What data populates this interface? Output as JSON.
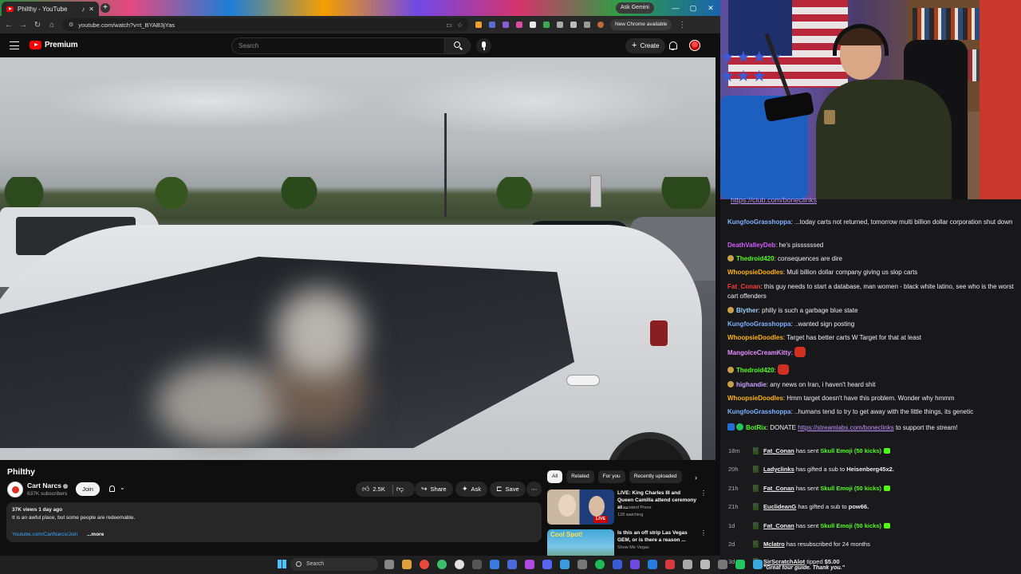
{
  "browser": {
    "tab_title": "Philthy - YouTube",
    "new_tab_symbol": "+",
    "ask_gemini": "Ask Gemini",
    "url": "youtube.com/watch?v=t_BYAB3jYas",
    "new_chrome": "New Chrome available"
  },
  "youtube": {
    "logo_text": "Premium",
    "search_placeholder": "Search",
    "create_label": "Create",
    "video": {
      "title": "Philthy",
      "channel": "Cart Narcs",
      "subscribers": "637K subscribers",
      "join_label": "Join",
      "likes": "2.5K",
      "share_label": "Share",
      "ask_label": "Ask",
      "save_label": "Save",
      "views_date": "37K views  1 day ago",
      "description": "It is an awful place, but some people are redeemable.",
      "desc_link": "Youtube.com/CartNarcs/Join",
      "more_label": "...more"
    },
    "chips": [
      "All",
      "Related",
      "For you",
      "Recently uploaded"
    ],
    "related": [
      {
        "title": "LIVE: King Charles III and Queen Camilla attend ceremony at ...",
        "channel": "Associated Press",
        "stat": "128 watching",
        "badge": "LIVE"
      },
      {
        "title": "Is this an off strip Las Vegas GEM, or is there a reason ...",
        "channel": "Show Me Vegas",
        "stat": ""
      }
    ]
  },
  "stream": {
    "chat_link_top": "https://club.com/boneclinks",
    "messages": [
      {
        "user": "KungfooGrasshoppa",
        "color": "#7fb2ff",
        "text": "...today carts not returned, tomorrow multi billion dollar corporation shut down"
      },
      {
        "user": "DeathValleyDeb",
        "color": "#d35cff",
        "text": "he's pissssssed"
      },
      {
        "user": "Thedroid420",
        "color": "#53fc18",
        "text": "consequences are dire",
        "badge": true
      },
      {
        "user": "WhoopsieDoodles",
        "color": "#ffb300",
        "text": "Muli billion dollar company giving us slop carts"
      },
      {
        "user": "Fat_Conan",
        "color": "#ff3b3b",
        "text": "this guy needs to start a database, man women - black white latino, see who is the worst cart offenders"
      },
      {
        "user": "Blyther",
        "color": "#9ad0ff",
        "text": "philly is such a garbage blue state",
        "badge": true
      },
      {
        "user": "KungfooGrasshoppa",
        "color": "#7fb2ff",
        "text": "..wanted sign posting"
      },
      {
        "user": "WhoopsieDoodles",
        "color": "#ffb300",
        "text": "Target has better carts W Target for that at least"
      },
      {
        "user": "MangoIceCreamKitty",
        "color": "#e68cff",
        "text": "",
        "emote": true
      },
      {
        "user": "Thedroid420",
        "color": "#53fc18",
        "text": "",
        "badge": true,
        "emote": true
      },
      {
        "user": "highandie",
        "color": "#c6a3ff",
        "text": "any news on Iran, i haven't heard shit",
        "badge": true
      },
      {
        "user": "WhoopsieDoodles",
        "color": "#ffb300",
        "text": "Hmm target doesn't have this problem. Wonder why hmmm"
      },
      {
        "user": "KungfooGrasshoppa",
        "color": "#7fb2ff",
        "text": "..humans tend to try to get away with the little things, its genetic"
      }
    ],
    "bot_message": {
      "user": "BotRix",
      "prefix": "DONATE",
      "link": "https://streamlabs.com/boneclinks",
      "suffix": "to support the stream!"
    },
    "events": [
      {
        "time": "18m",
        "user": "Fat_Conan",
        "action": "has sent",
        "item": "Skull Emoji (50 kicks)",
        "coin": true
      },
      {
        "time": "20h",
        "user": "Ladyclinks",
        "action": "has gifted a sub to",
        "item": "Heisenberg45x2."
      },
      {
        "time": "21h",
        "user": "Fat_Conan",
        "action": "has sent",
        "item": "Skull Emoji (50 kicks)",
        "coin": true
      },
      {
        "time": "21h",
        "user": "EuclideanG",
        "action": "has gifted a sub to",
        "item": "pow66."
      },
      {
        "time": "1d",
        "user": "Fat_Conan",
        "action": "has sent",
        "item": "Skull Emoji (50 kicks)",
        "coin": true
      },
      {
        "time": "2d",
        "user": "Mclatro",
        "action": "has resubscribed for 24 months",
        "item": ""
      },
      {
        "time": "3d",
        "user": "SirScratchAlot",
        "action": "tipped",
        "item": "$5.00",
        "quote": "\"Great tour guide. Thank you.\""
      }
    ]
  },
  "taskbar": {
    "search_label": "Search"
  },
  "colors": {
    "yt_red": "#ff0000",
    "link_blue": "#3ea6ff",
    "kick_green": "#53fc18",
    "twitch_purple": "#bf94ff"
  }
}
